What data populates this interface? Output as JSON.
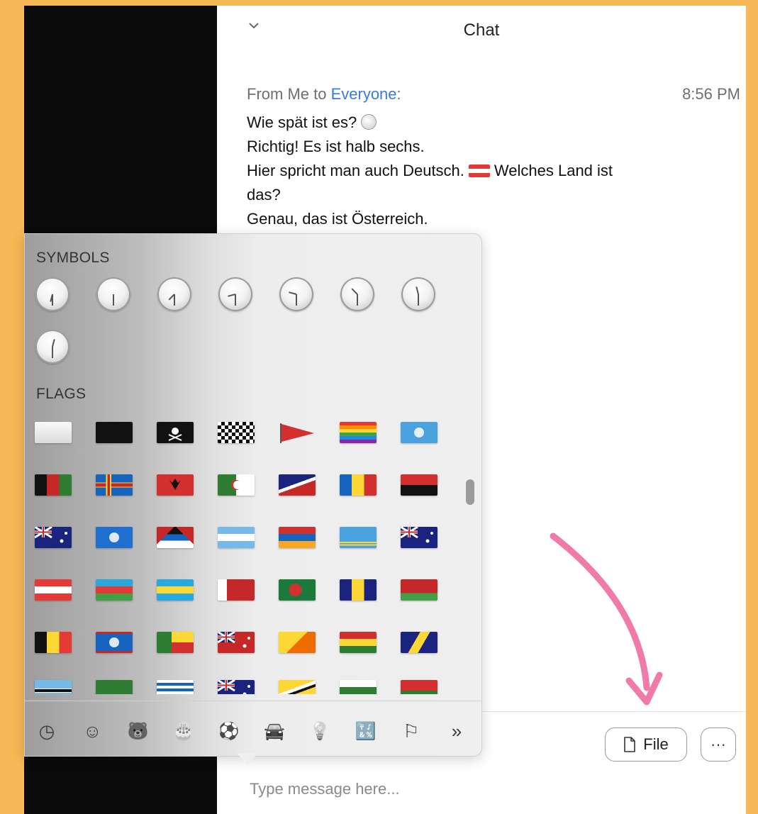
{
  "chat": {
    "title": "Chat",
    "meta_prefix": "From Me to ",
    "meta_target": "Everyone",
    "meta_suffix": ":",
    "time": "8:56 PM",
    "messages": {
      "m1": "Wie spät ist es?",
      "m2": "Richtig! Es ist halb sechs.",
      "m3a": "Hier spricht man auch Deutsch.",
      "m3b": "Welches Land ist",
      "m3c": "das?",
      "m4": "Genau, das ist Österreich."
    },
    "file_button": "File",
    "more_button": "···",
    "input_placeholder": "Type message here..."
  },
  "picker": {
    "symbols_label": "SYMBOLS",
    "flags_label": "FLAGS",
    "clocks": [
      "clock-half-past-six",
      "clock-half-past-seven",
      "clock-half-past-eight",
      "clock-half-past-nine",
      "clock-half-past-ten",
      "clock-half-past-eleven",
      "clock-half-past-twelve",
      "clock-half-past-five"
    ],
    "flags": [
      "white-flag",
      "black-flag",
      "pirate-flag",
      "chequered-flag",
      "triangular-flag",
      "rainbow-flag",
      "united-nations",
      "afghanistan",
      "aland-islands",
      "albania",
      "algeria",
      "american-samoa",
      "andorra",
      "angola",
      "anguilla",
      "antarctica",
      "antigua-barbuda",
      "argentina",
      "armenia",
      "aruba",
      "australia",
      "austria",
      "azerbaijan",
      "bahamas",
      "bahrain",
      "bangladesh",
      "barbados",
      "belarus",
      "belgium",
      "belize",
      "benin",
      "bermuda",
      "bhutan",
      "bolivia",
      "bosnia",
      "botswana",
      "brazil",
      "british-indian-ocean",
      "british-virgin-islands",
      "brunei",
      "bulgaria",
      "burkina-faso"
    ],
    "categories": [
      {
        "name": "recent-icon",
        "glyph": "◷"
      },
      {
        "name": "smileys-icon",
        "glyph": "☺"
      },
      {
        "name": "animals-icon",
        "glyph": "🐻"
      },
      {
        "name": "food-icon",
        "glyph": "🎂"
      },
      {
        "name": "activity-icon",
        "glyph": "⚽"
      },
      {
        "name": "travel-icon",
        "glyph": "🚘"
      },
      {
        "name": "objects-icon",
        "glyph": "💡"
      },
      {
        "name": "symbols-category-icon",
        "glyph": "🔣"
      },
      {
        "name": "flags-category-icon",
        "glyph": "⚐"
      },
      {
        "name": "more-categories-icon",
        "glyph": "»"
      }
    ]
  },
  "colors": {
    "background": "#f6b955",
    "accent": "#3a7bd5",
    "arrow": "#f07aa8"
  }
}
